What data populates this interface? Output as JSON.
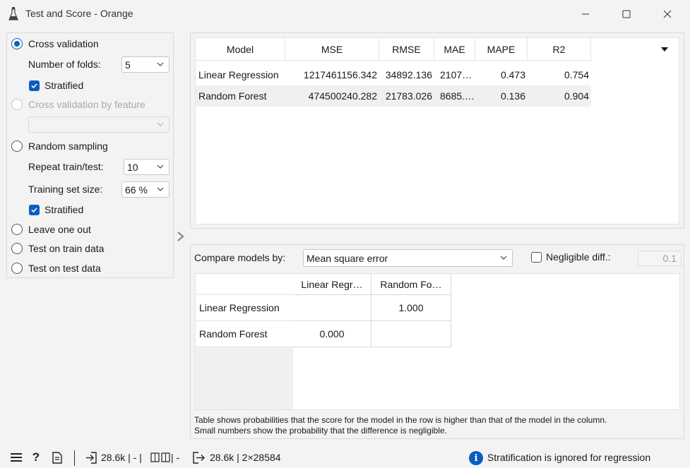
{
  "window": {
    "title": "Test and Score - Orange"
  },
  "sampling": {
    "cross_validation_label": "Cross validation",
    "number_of_folds_label": "Number of folds:",
    "number_of_folds_value": "5",
    "stratified_1_label": "Stratified",
    "cv_by_feature_label": "Cross validation by feature",
    "random_sampling_label": "Random sampling",
    "repeat_label": "Repeat train/test:",
    "repeat_value": "10",
    "training_size_label": "Training set size:",
    "training_size_value": "66 %",
    "stratified_2_label": "Stratified",
    "leave_one_out_label": "Leave one out",
    "test_on_train_label": "Test on train data",
    "test_on_test_label": "Test on test data",
    "selected": "Cross validation"
  },
  "results": {
    "columns": [
      "Model",
      "MSE",
      "RMSE",
      "MAE",
      "MAPE",
      "R2"
    ],
    "rows": [
      [
        "Linear Regression",
        "1217461156.342",
        "34892.136",
        "2107…",
        "0.473",
        "0.754"
      ],
      [
        "Random Forest",
        "474500240.282",
        "21783.026",
        "8685.…",
        "0.136",
        "0.904"
      ]
    ]
  },
  "compare": {
    "label": "Compare models by:",
    "value": "Mean square error",
    "negligible_label": "Negligible diff.:",
    "negligible_value": "0.1",
    "columns": [
      "Linear Regr…",
      "Random Fo…"
    ],
    "rows": [
      {
        "name": "Linear Regression",
        "cells": [
          "",
          "1.000"
        ]
      },
      {
        "name": "Random Forest",
        "cells": [
          "0.000",
          ""
        ]
      }
    ],
    "footnote_line1": "Table shows probabilities that the score for the model in the row is higher than that of the model in the column.",
    "footnote_line2": "Small numbers show the probability that the difference is negligible."
  },
  "statusbar": {
    "input_count": "28.6k | - | ",
    "mid_text": " | -",
    "output_count": "28.6k | 2×28584",
    "message": "Stratification is ignored for regression"
  },
  "colors": {
    "accent": "#0a5ec1",
    "background": "#f3f3f3"
  }
}
